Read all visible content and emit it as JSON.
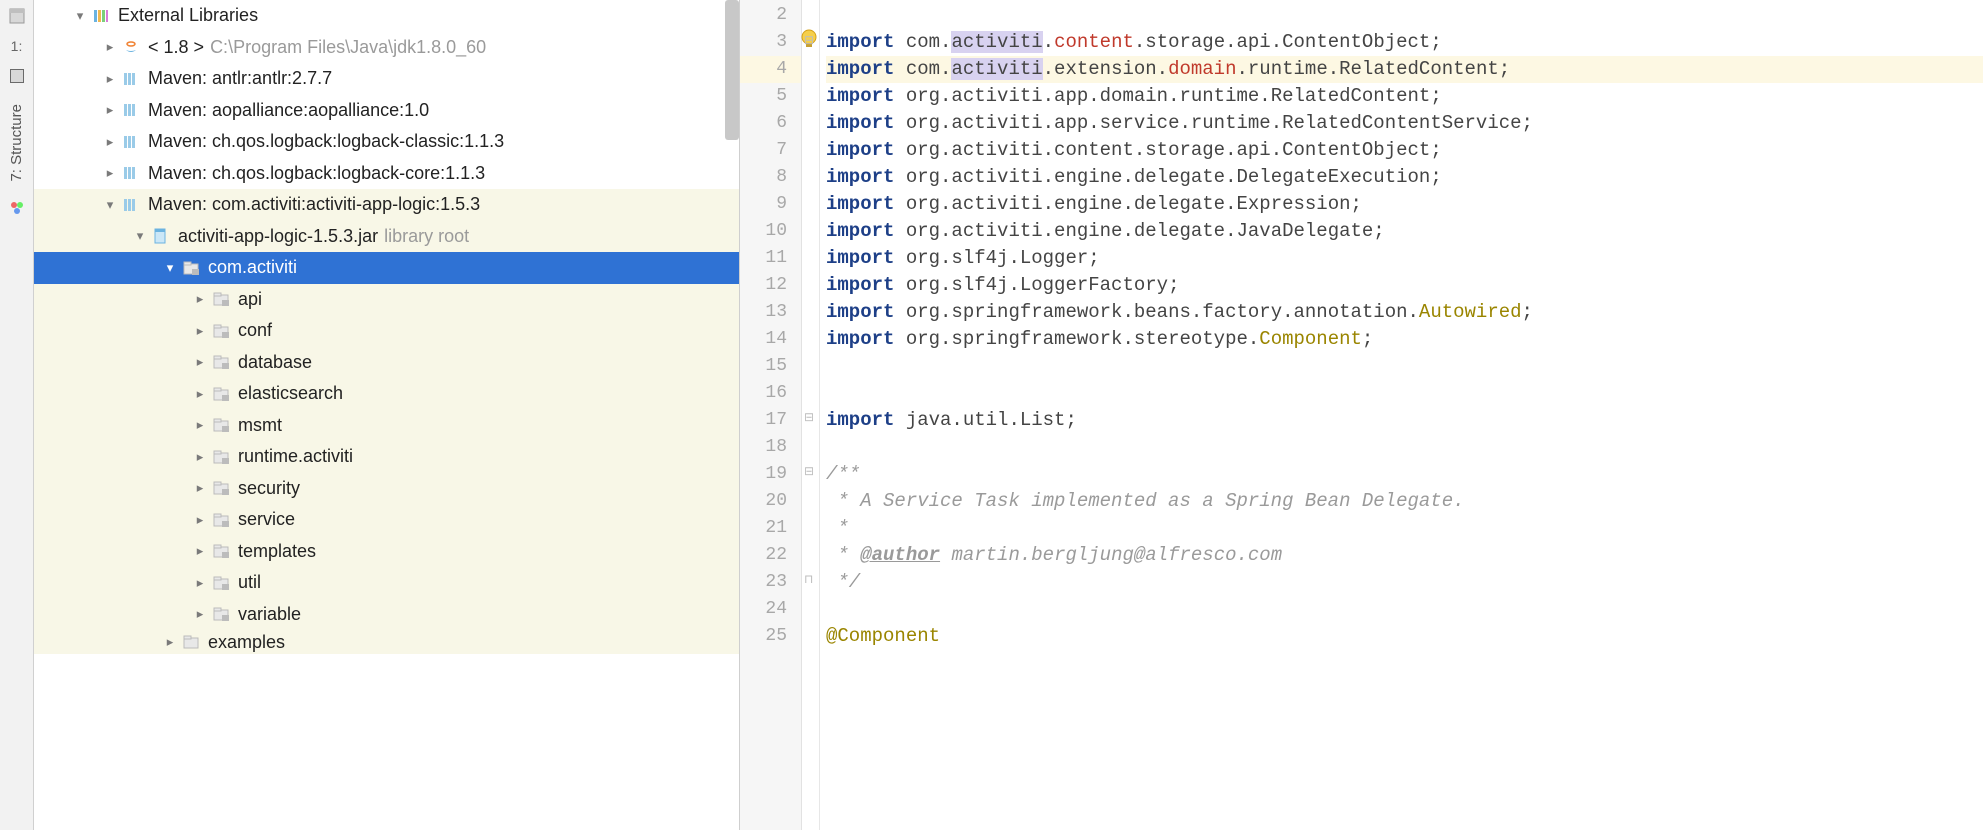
{
  "toolwindows": {
    "project_label": "1:",
    "structure_label": "7: Structure"
  },
  "tree": {
    "root": "External Libraries",
    "jdk_label": "< 1.8 >",
    "jdk_path": "C:\\Program Files\\Java\\jdk1.8.0_60",
    "libs": [
      "Maven: antlr:antlr:2.7.7",
      "Maven: aopalliance:aopalliance:1.0",
      "Maven: ch.qos.logback:logback-classic:1.1.3",
      "Maven: ch.qos.logback:logback-core:1.1.3",
      "Maven: com.activiti:activiti-app-logic:1.5.3"
    ],
    "jar_label": "activiti-app-logic-1.5.3.jar",
    "jar_hint": "library root",
    "selected_pkg": "com.activiti",
    "pkgs": [
      "api",
      "conf",
      "database",
      "elasticsearch",
      "msmt",
      "runtime.activiti",
      "security",
      "service",
      "templates",
      "util",
      "variable"
    ],
    "trailing": "examples"
  },
  "code": {
    "lines": [
      {
        "n": 2,
        "parts": []
      },
      {
        "n": 3,
        "parts": [
          {
            "t": "import ",
            "c": "kw"
          },
          {
            "t": "com.",
            "c": "pkg"
          },
          {
            "t": "activiti",
            "c": "sel pkg"
          },
          {
            "t": ".",
            "c": "pkg"
          },
          {
            "t": "content",
            "c": "err"
          },
          {
            "t": ".storage.api.ContentObject;",
            "c": "pkg"
          }
        ]
      },
      {
        "n": 4,
        "hl": true,
        "parts": [
          {
            "t": "import ",
            "c": "kw"
          },
          {
            "t": "com.",
            "c": "pkg"
          },
          {
            "t": "activiti",
            "c": "sel pkg"
          },
          {
            "t": ".extension.",
            "c": "pkg"
          },
          {
            "t": "domain",
            "c": "err"
          },
          {
            "t": ".runtime.RelatedContent;",
            "c": "pkg"
          }
        ]
      },
      {
        "n": 5,
        "parts": [
          {
            "t": "import ",
            "c": "kw"
          },
          {
            "t": "org.activiti.app.domain.runtime.RelatedContent;",
            "c": "pkg"
          }
        ]
      },
      {
        "n": 6,
        "parts": [
          {
            "t": "import ",
            "c": "kw"
          },
          {
            "t": "org.activiti.app.service.runtime.RelatedContentService;",
            "c": "pkg"
          }
        ]
      },
      {
        "n": 7,
        "parts": [
          {
            "t": "import ",
            "c": "kw"
          },
          {
            "t": "org.activiti.content.storage.api.ContentObject;",
            "c": "pkg"
          }
        ]
      },
      {
        "n": 8,
        "parts": [
          {
            "t": "import ",
            "c": "kw"
          },
          {
            "t": "org.activiti.engine.delegate.DelegateExecution;",
            "c": "pkg"
          }
        ]
      },
      {
        "n": 9,
        "parts": [
          {
            "t": "import ",
            "c": "kw"
          },
          {
            "t": "org.activiti.engine.delegate.Expression;",
            "c": "pkg"
          }
        ]
      },
      {
        "n": 10,
        "parts": [
          {
            "t": "import ",
            "c": "kw"
          },
          {
            "t": "org.activiti.engine.delegate.JavaDelegate;",
            "c": "pkg"
          }
        ]
      },
      {
        "n": 11,
        "parts": [
          {
            "t": "import ",
            "c": "kw"
          },
          {
            "t": "org.slf4j.Logger;",
            "c": "pkg"
          }
        ]
      },
      {
        "n": 12,
        "parts": [
          {
            "t": "import ",
            "c": "kw"
          },
          {
            "t": "org.slf4j.LoggerFactory;",
            "c": "pkg"
          }
        ]
      },
      {
        "n": 13,
        "parts": [
          {
            "t": "import ",
            "c": "kw"
          },
          {
            "t": "org.springframework.beans.factory.annotation.",
            "c": "pkg"
          },
          {
            "t": "Autowired",
            "c": "ann"
          },
          {
            "t": ";",
            "c": "pkg"
          }
        ]
      },
      {
        "n": 14,
        "parts": [
          {
            "t": "import ",
            "c": "kw"
          },
          {
            "t": "org.springframework.stereotype.",
            "c": "pkg"
          },
          {
            "t": "Component",
            "c": "ann"
          },
          {
            "t": ";",
            "c": "pkg"
          }
        ]
      },
      {
        "n": 15,
        "parts": []
      },
      {
        "n": 16,
        "parts": []
      },
      {
        "n": 17,
        "parts": [
          {
            "t": "import ",
            "c": "kw"
          },
          {
            "t": "java.util.List;",
            "c": "pkg"
          }
        ]
      },
      {
        "n": 18,
        "parts": []
      },
      {
        "n": 19,
        "parts": [
          {
            "t": "/**",
            "c": "cmt"
          }
        ]
      },
      {
        "n": 20,
        "parts": [
          {
            "t": " * A Service Task implemented as a Spring Bean Delegate.",
            "c": "cmt"
          }
        ]
      },
      {
        "n": 21,
        "parts": [
          {
            "t": " *",
            "c": "cmt"
          }
        ]
      },
      {
        "n": 22,
        "parts": [
          {
            "t": " * ",
            "c": "cmt"
          },
          {
            "t": "@author",
            "c": "doctag"
          },
          {
            "t": " martin.bergljung@alfresco.com",
            "c": "cmt"
          }
        ]
      },
      {
        "n": 23,
        "parts": [
          {
            "t": " */",
            "c": "cmt"
          }
        ]
      },
      {
        "n": 24,
        "parts": []
      },
      {
        "n": 25,
        "parts": [
          {
            "t": "@Component",
            "c": "ann"
          }
        ]
      }
    ]
  }
}
